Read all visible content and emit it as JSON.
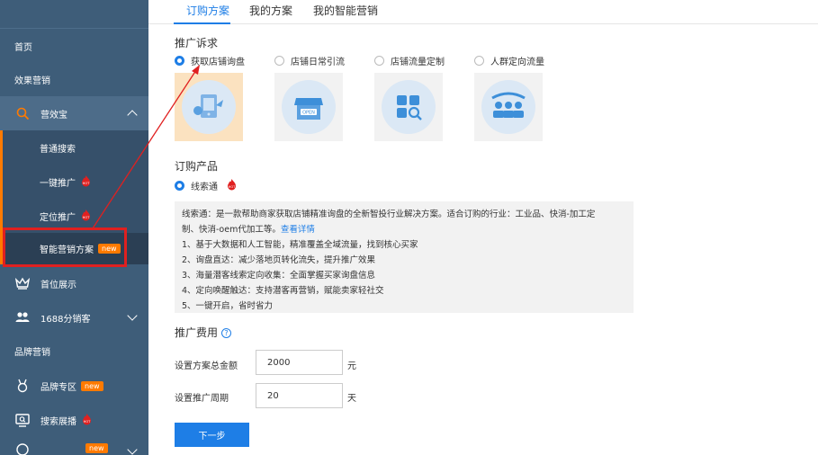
{
  "sidebar": {
    "items": [
      {
        "label": "首页"
      },
      {
        "label": "效果营销"
      },
      {
        "label": "营效宝"
      },
      {
        "label": "普通搜索"
      },
      {
        "label": "一键推广",
        "badge": "HOT"
      },
      {
        "label": "定位推广",
        "badge": "HOT"
      },
      {
        "label": "智能营销方案",
        "badge": "new"
      },
      {
        "label": "首位展示"
      },
      {
        "label": "1688分销客"
      },
      {
        "label": "品牌营销"
      },
      {
        "label": "品牌专区",
        "badge": "new"
      },
      {
        "label": "搜索展播",
        "badge": "HOT"
      },
      {
        "label": "",
        "badge": "new"
      }
    ]
  },
  "tabs": [
    {
      "label": "订购方案"
    },
    {
      "label": "我的方案"
    },
    {
      "label": "我的智能营销"
    }
  ],
  "promo_goal": {
    "title": "推广诉求",
    "options": [
      {
        "label": "获取店铺询盘",
        "selected": true
      },
      {
        "label": "店铺日常引流",
        "selected": false
      },
      {
        "label": "店铺流量定制",
        "selected": false
      },
      {
        "label": "人群定向流量",
        "selected": false
      }
    ]
  },
  "product": {
    "title": "订购产品",
    "option": "线索通",
    "badge": "HOT"
  },
  "description": {
    "line1": "线索通：是一款帮助商家获取店铺精准询盘的全新智投行业解决方案。适合订购的行业：工业品、快消-加工定",
    "line2": "制、快消-oem代加工等。",
    "link": "查看详情",
    "points": [
      "1、基于大数据和人工智能，精准覆盖全域流量，找到核心买家",
      "2、询盘直达：减少落地页转化流失，提升推广效果",
      "3、海量潜客线索定向收集：全面掌握买家询盘信息",
      "4、定向唤醒触达：支持潜客再营销，赋能卖家轻社交",
      "5、一键开启，省时省力"
    ]
  },
  "fee": {
    "title": "推广费用",
    "help": "?",
    "amount_label": "设置方案总金额",
    "amount_value": "2000",
    "amount_unit": "元",
    "period_label": "设置推广周期",
    "period_value": "20",
    "period_unit": "天"
  },
  "next_button": "下一步",
  "colors": {
    "sidebar": "#3e5d79",
    "accent": "#1e7ee6",
    "hot": "#e02020",
    "new": "#ff7a00"
  }
}
